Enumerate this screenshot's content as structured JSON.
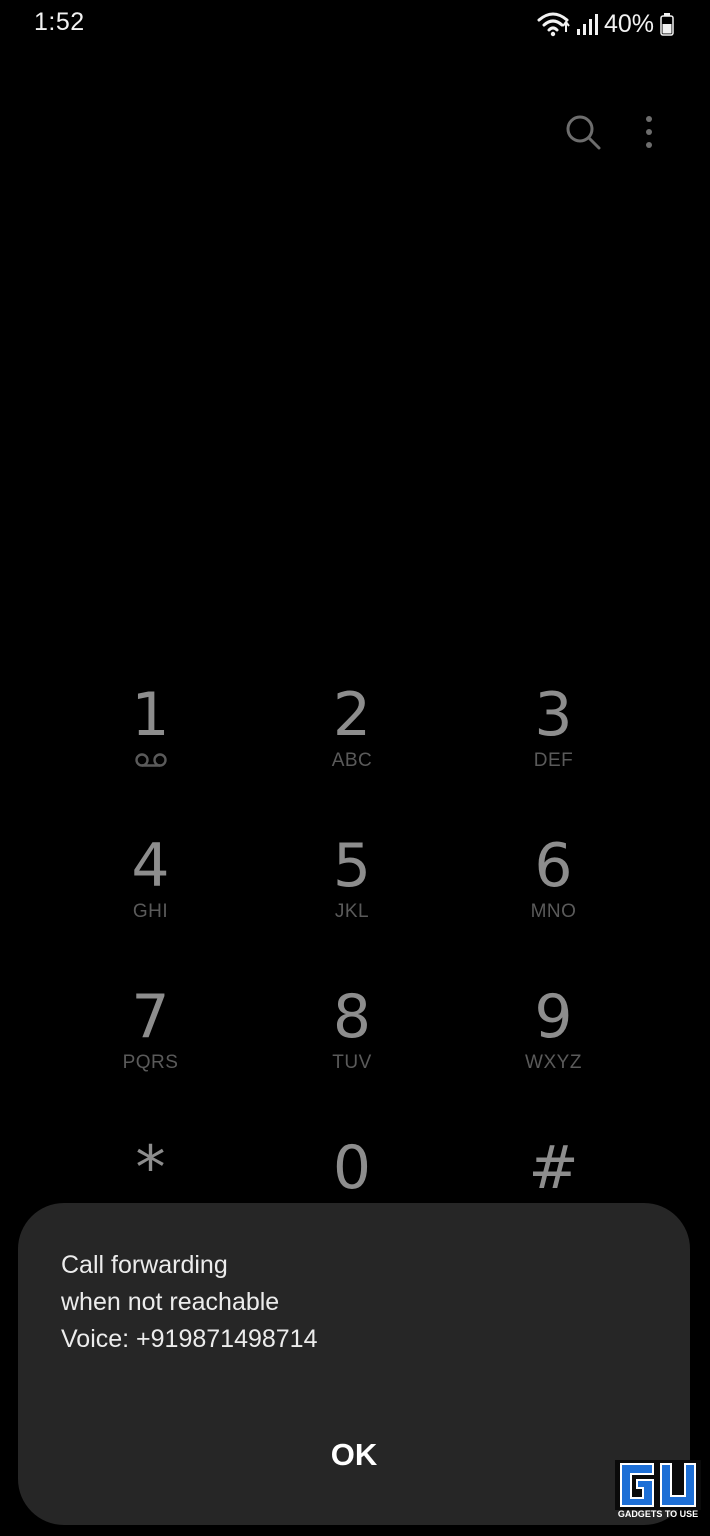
{
  "status_bar": {
    "time": "1:52",
    "battery_percent": "40%",
    "icons": [
      "wifi-icon",
      "signal-icon",
      "battery-icon"
    ]
  },
  "toolbar": {
    "icons": [
      "search-icon",
      "more-options-icon"
    ]
  },
  "dialpad": {
    "keys": [
      {
        "digit": "1",
        "letters": "",
        "icon": "voicemail-icon"
      },
      {
        "digit": "2",
        "letters": "ABC"
      },
      {
        "digit": "3",
        "letters": "DEF"
      },
      {
        "digit": "4",
        "letters": "GHI"
      },
      {
        "digit": "5",
        "letters": "JKL"
      },
      {
        "digit": "6",
        "letters": "MNO"
      },
      {
        "digit": "7",
        "letters": "PQRS"
      },
      {
        "digit": "8",
        "letters": "TUV"
      },
      {
        "digit": "9",
        "letters": "WXYZ"
      },
      {
        "digit": "*",
        "letters": ""
      },
      {
        "digit": "0",
        "letters": ""
      },
      {
        "digit": "#",
        "letters": ""
      }
    ]
  },
  "dialog": {
    "lines": [
      "Call forwarding",
      "when not reachable",
      "Voice: +919871498714"
    ],
    "ok_label": "OK"
  },
  "watermark": {
    "caption": "GADGETS TO USE",
    "logo_text": "GU"
  },
  "colors": {
    "background": "#000000",
    "dialog_background": "#262626",
    "digit": "#8d8d8d",
    "letters": "#5a5a5a",
    "watermark_blue": "#1d6fd6"
  }
}
